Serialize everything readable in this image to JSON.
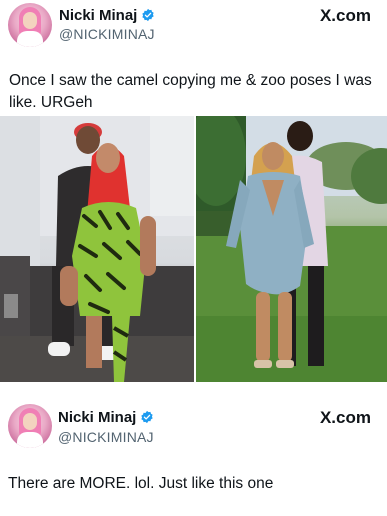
{
  "tweets": [
    {
      "author": {
        "name": "Nicki Minaj",
        "handle": "@NICKIMINAJ",
        "verified": true,
        "avatar": "avatar-pink-portrait"
      },
      "source": "X.com",
      "text": "Once I saw the camel copying me & zoo poses I was like. URGeh",
      "media": [
        {
          "subject": "woman in green zebra-print dress with red hair beside man in cap",
          "setting": "indoor lounge"
        },
        {
          "subject": "woman in light blue blazer dress beside man in suit",
          "setting": "outdoor lawn"
        }
      ]
    },
    {
      "author": {
        "name": "Nicki Minaj",
        "handle": "@NICKIMINAJ",
        "verified": true,
        "avatar": "avatar-pink-portrait"
      },
      "source": "X.com",
      "text": "There are MORE. lol. Just like this one"
    }
  ],
  "icons": {
    "verified": "verified-badge-icon",
    "verified_color": "#1d9bf0"
  }
}
